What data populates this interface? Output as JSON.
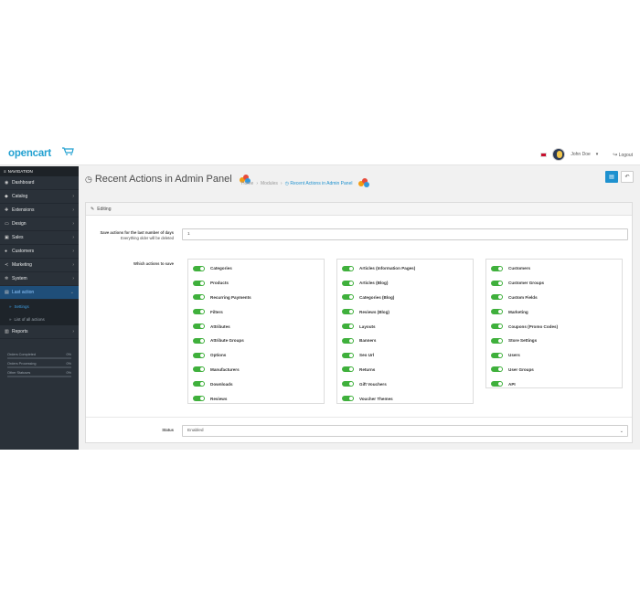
{
  "header": {
    "logo_text": "opencart",
    "user_name": "John Doe",
    "user_caret": "▾",
    "logout_label": "Logout"
  },
  "sidebar": {
    "nav_title": "NAVIGATION",
    "items": [
      {
        "label": "Dashboard",
        "icon": "dashboard-icon",
        "glyph": "◉",
        "chevron": ""
      },
      {
        "label": "Catalog",
        "icon": "tag-icon",
        "glyph": "◆",
        "chevron": "›"
      },
      {
        "label": "Extensions",
        "icon": "puzzle-icon",
        "glyph": "✚",
        "chevron": "›"
      },
      {
        "label": "Design",
        "icon": "monitor-icon",
        "glyph": "▭",
        "chevron": "›"
      },
      {
        "label": "Sales",
        "icon": "cart-icon",
        "glyph": "▣",
        "chevron": "›"
      },
      {
        "label": "Customers",
        "icon": "user-icon",
        "glyph": "●",
        "chevron": "›"
      },
      {
        "label": "Marketing",
        "icon": "share-icon",
        "glyph": "≺",
        "chevron": "›"
      },
      {
        "label": "System",
        "icon": "cog-icon",
        "glyph": "✲",
        "chevron": "›"
      },
      {
        "label": "Last action",
        "icon": "list-icon",
        "glyph": "▤",
        "chevron": "⌄"
      }
    ],
    "sub_items": [
      {
        "label": "Settings"
      },
      {
        "label": "List of all actions"
      }
    ],
    "reports": {
      "label": "Reports",
      "glyph": "▥",
      "chevron": "›"
    },
    "stats": [
      {
        "label": "Orders Completed",
        "value": "0%",
        "fraction": 0
      },
      {
        "label": "Orders Processing",
        "value": "0%",
        "fraction": 0
      },
      {
        "label": "Other Statuses",
        "value": "0%",
        "fraction": 0
      }
    ]
  },
  "page": {
    "title": "Recent Actions in Admin Panel",
    "breadcrumb": [
      "Home",
      "Modules",
      "Recent Actions in Admin Panel"
    ],
    "breadcrumb_sep": "›",
    "panel_title": "Editing",
    "save_days_label": "Save actions for the last number of days",
    "save_days_hint": "Everything older will be deleted",
    "save_days_value": "1",
    "which_actions_label": "Which actions to save",
    "status_label": "Status",
    "status_value": "Enabled"
  },
  "actions": {
    "col1": [
      "Categories",
      "Products",
      "Recurring Payments",
      "Filters",
      "Attributes",
      "Attribute Groups",
      "Options",
      "Manufacturers",
      "Downloads",
      "Reviews"
    ],
    "col2": [
      "Articles (Information Pages)",
      "Articles (Blog)",
      "Categories (Blog)",
      "Reviews (Blog)",
      "Layouts",
      "Banners",
      "Seo Url",
      "Returns",
      "Gift Vouchers",
      "Voucher Themes"
    ],
    "col3": [
      "Customers",
      "Customer Groups",
      "Custom Fields",
      "Marketing",
      "Coupons (Promo Codes)",
      "Store Settings",
      "Users",
      "User Groups",
      "API"
    ]
  },
  "colors": {
    "sidebar_bg": "#2a3139",
    "accent": "#1e91cf",
    "toggle_on": "#3fb03c",
    "active_nav": "#1f4e79"
  }
}
